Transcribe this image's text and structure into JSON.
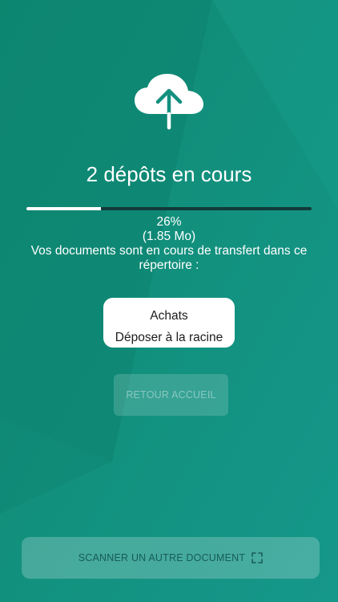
{
  "upload": {
    "title": "2 dépôts en cours",
    "percent_text": "26%",
    "progress_fraction": 0.26,
    "size_text": "(1.85 Mo)",
    "message": "Vos documents sont en cours de transfert dans ce répertoire :"
  },
  "folder": {
    "name": "Achats",
    "action": "Déposer à la racine"
  },
  "buttons": {
    "back_home": "RETOUR ACCUEIL",
    "scan_another": "SCANNER UN AUTRE DOCUMENT"
  },
  "icons": {
    "upload": "cloud-upload-icon",
    "scan": "scan-frame-icon"
  },
  "colors": {
    "background": "#13907e",
    "progress_track": "#123a3a",
    "progress_fill": "#ffffff"
  }
}
